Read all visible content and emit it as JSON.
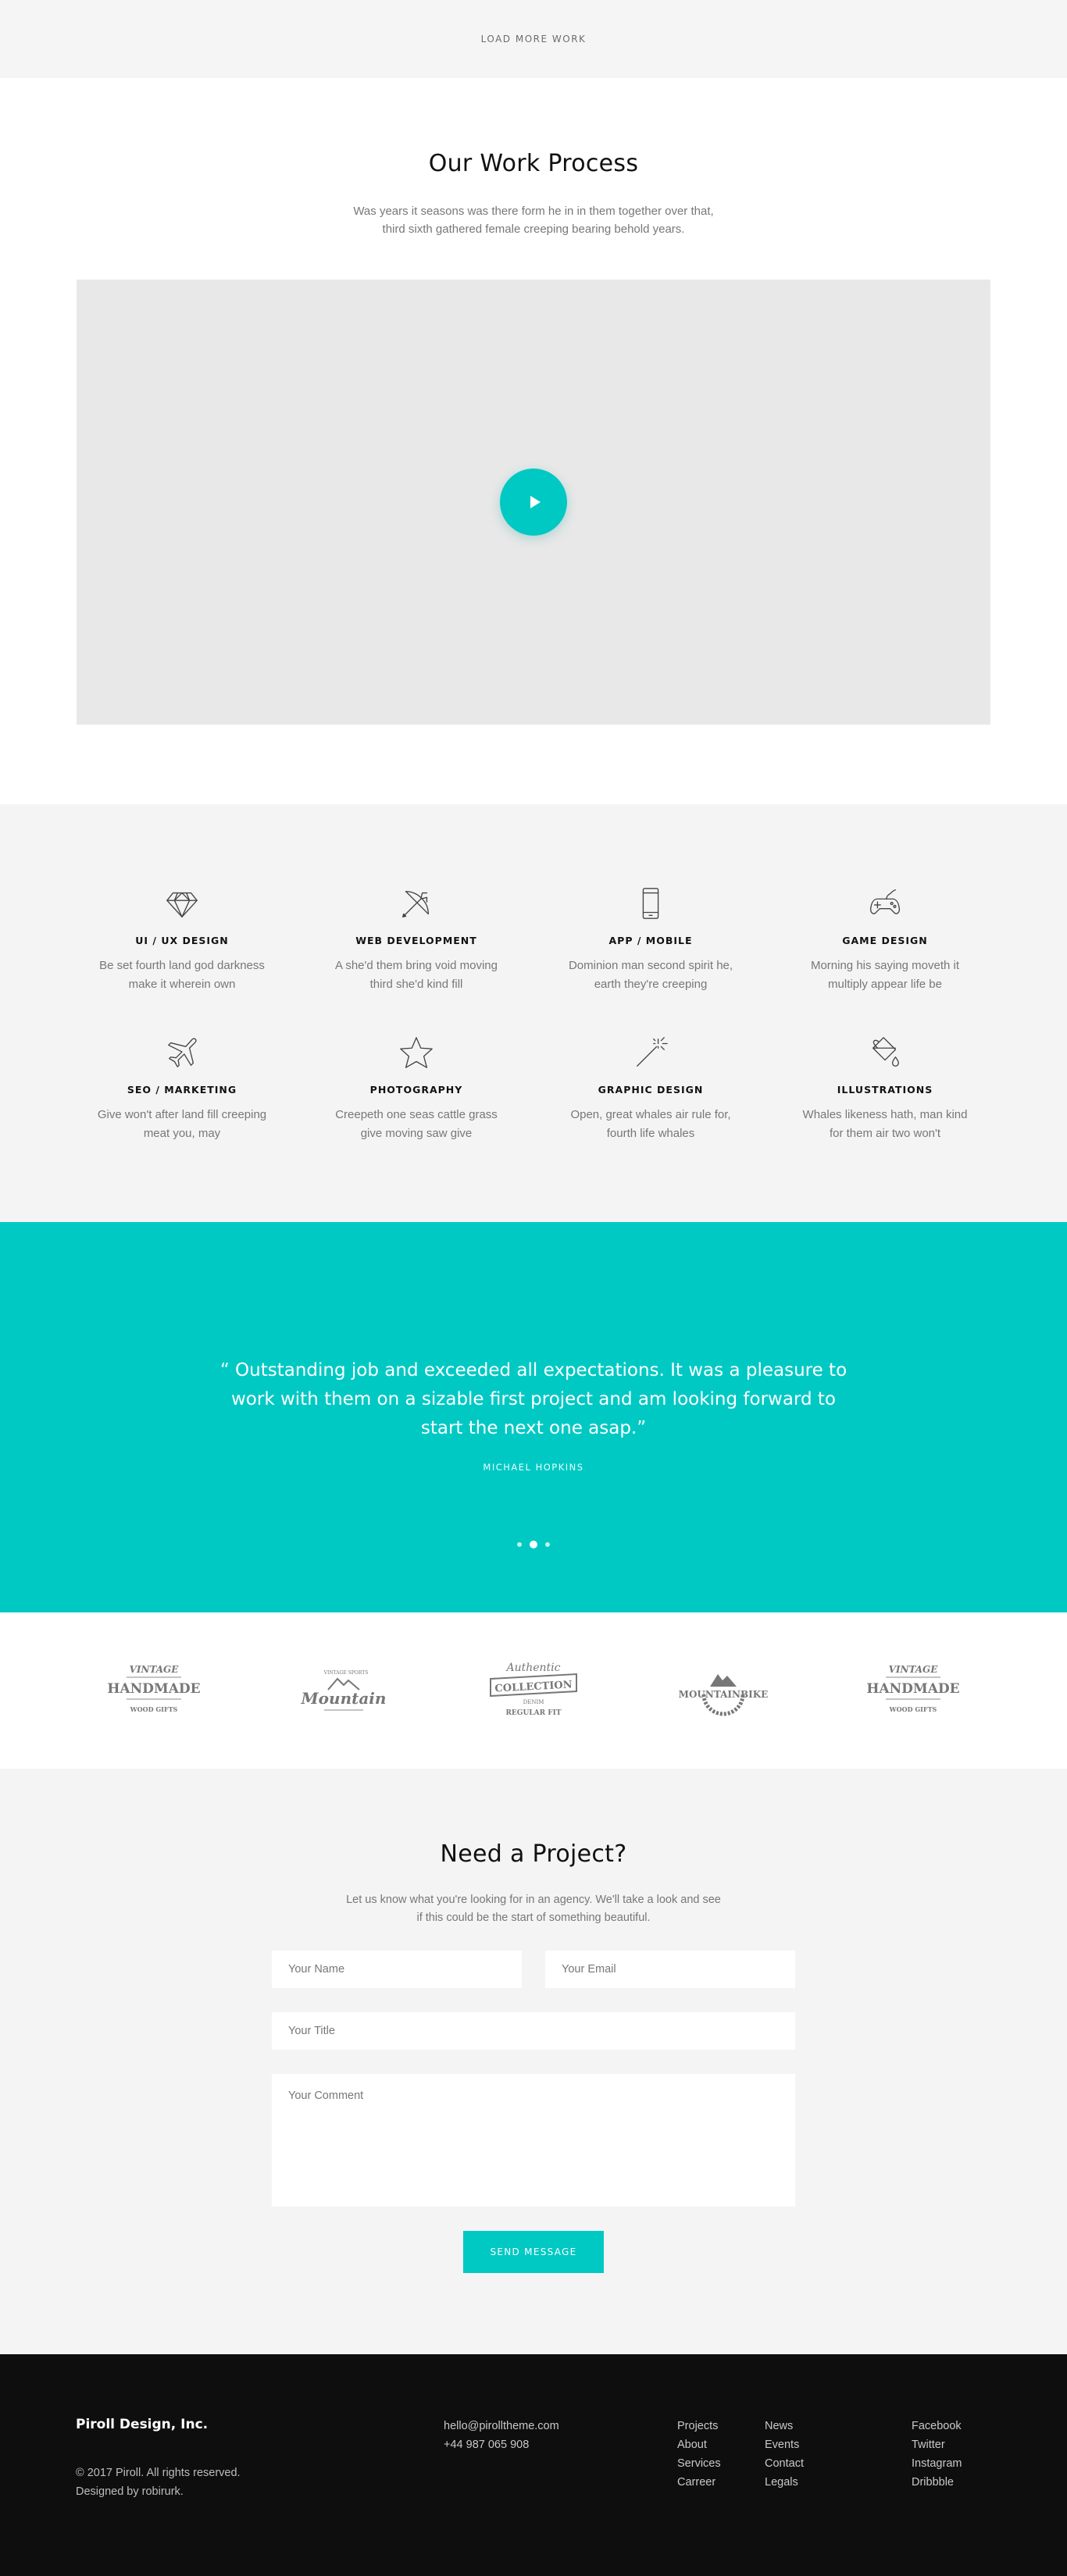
{
  "load_more": {
    "label": "LOAD MORE WORK"
  },
  "process": {
    "title": "Our Work Process",
    "text_line1": "Was years it seasons was there form he in in them together over that,",
    "text_line2": "third sixth gathered female creeping bearing behold years."
  },
  "services": [
    {
      "icon": "diamond-icon",
      "title": "UI / UX DESIGN",
      "text1": "Be set fourth land god darkness",
      "text2": "make it wherein own"
    },
    {
      "icon": "bow-arrow-icon",
      "title": "WEB DEVELOPMENT",
      "text1": "A she'd them bring void moving",
      "text2": "third she'd kind fill"
    },
    {
      "icon": "smartphone-icon",
      "title": "APP / MOBILE",
      "text1": "Dominion man second spirit he,",
      "text2": "earth they're creeping"
    },
    {
      "icon": "gamepad-icon",
      "title": "GAME DESIGN",
      "text1": "Morning his saying moveth it",
      "text2": "multiply appear life be"
    },
    {
      "icon": "airplane-icon",
      "title": "SEO / MARKETING",
      "text1": "Give won't after land fill creeping",
      "text2": "meat you, may"
    },
    {
      "icon": "star-icon",
      "title": "PHOTOGRAPHY",
      "text1": "Creepeth one seas cattle grass",
      "text2": "give moving saw give"
    },
    {
      "icon": "magic-wand-icon",
      "title": "GRAPHIC DESIGN",
      "text1": "Open, great whales air rule for,",
      "text2": "fourth life whales"
    },
    {
      "icon": "paint-bucket-icon",
      "title": "ILLUSTRATIONS",
      "text1": "Whales likeness hath, man kind",
      "text2": "for them air two won't"
    }
  ],
  "testimonial": {
    "quote": "“ Outstanding job and exceeded all expectations. It was a pleasure to work with them on a sizable first project and am looking forward to start the next one asap.”",
    "author": "MICHAEL HOPKINS"
  },
  "clients": {
    "logo1": {
      "top": "VINTAGE",
      "mid": "HANDMADE",
      "bottom": "WOOD GIFTS"
    },
    "logo2": {
      "top": "VINTAGE SPORTS",
      "mid": "Mountain"
    },
    "logo3": {
      "top": "Authentic",
      "mid": "COLLECTION",
      "sub": "DENIM",
      "bottom": "REGULAR FIT"
    },
    "logo4": {
      "mid": "MOUNTAINBIKE"
    },
    "logo5": {
      "top": "VINTAGE",
      "mid": "HANDMADE",
      "bottom": "WOOD GIFTS"
    }
  },
  "contact": {
    "title": "Need a Project?",
    "text_line1": "Let us know what you're looking for in an agency. We'll take a look and see",
    "text_line2": "if this could be the start of something beautiful.",
    "name_placeholder": "Your Name",
    "email_placeholder": "Your Email",
    "title_placeholder": "Your Title",
    "comment_placeholder": "Your Comment",
    "send_label": "SEND MESSAGE"
  },
  "footer": {
    "brand": "Piroll Design, Inc.",
    "copyright": "© 2017 Piroll. All rights reserved.",
    "designed": "Designed by robirurk.",
    "email": "hello@pirolltheme.com",
    "phone": "+44 987 065 908",
    "col1": [
      "Projects",
      "About",
      "Services",
      "Carreer"
    ],
    "col2": [
      "News",
      "Events",
      "Contact",
      "Legals"
    ],
    "col3": [
      "Facebook",
      "Twitter",
      "Instagram",
      "Dribbble"
    ]
  },
  "colors": {
    "accent": "#00c9c4",
    "footer_bg": "#0e0e0e",
    "section_bg": "#f4f4f4"
  }
}
